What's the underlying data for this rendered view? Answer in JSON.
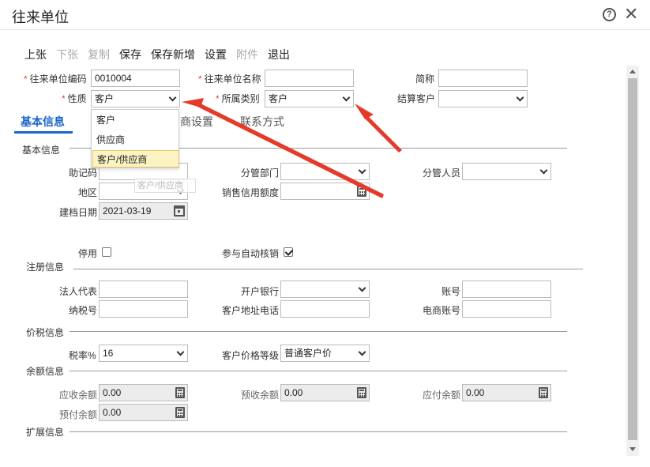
{
  "window": {
    "title": "往来单位",
    "help_icon": "question-circle-icon",
    "close_icon": "close-icon",
    "close_glyph": "✕",
    "help_glyph": "?"
  },
  "toolbar": {
    "prev": "上张",
    "next": "下张",
    "copy": "复制",
    "save": "保存",
    "save_new": "保存新增",
    "settings": "设置",
    "attachment": "附件",
    "exit": "退出"
  },
  "header_fields": {
    "code_label": "往来单位编码",
    "code_value": "0010004",
    "name_label": "往来单位名称",
    "name_value": "",
    "short_label": "简称",
    "short_value": "",
    "nature_label": "性质",
    "nature_value": "客户",
    "category_label": "所属类别",
    "category_value": "客户",
    "settle_label": "结算客户",
    "settle_value": "",
    "required_mark": "*"
  },
  "nature_dropdown": {
    "options": [
      "客户",
      "供应商",
      "客户/供应商"
    ],
    "highlighted": "客户/供应商"
  },
  "tabs": [
    {
      "label": "基本信息"
    },
    {
      "label": "商设置"
    },
    {
      "label": "联系方式"
    }
  ],
  "ghost_tooltip": "客户/供应商",
  "basic": {
    "section_label": "基本信息",
    "mnemonic_label": "助记码",
    "mnemonic_value": "",
    "dept_label": "分管部门",
    "dept_value": "",
    "staff_label": "分管人员",
    "staff_value": "",
    "region_label": "地区",
    "region_value": "",
    "credit_label": "销售信用额度",
    "credit_value": "",
    "created_label": "建档日期",
    "created_value": "2021-03-19",
    "disabled_label": "停用",
    "disabled_checked": false,
    "auto_writeoff_label": "参与自动核销",
    "auto_writeoff_checked": true
  },
  "registration": {
    "section_label": "注册信息",
    "legal_rep_label": "法人代表",
    "legal_rep_value": "",
    "bank_label": "开户银行",
    "bank_value": "",
    "account_label": "账号",
    "account_value": "",
    "tax_id_label": "纳税号",
    "tax_id_value": "",
    "address_phone_label": "客户地址电话",
    "address_phone_value": "",
    "ecommerce_label": "电商账号",
    "ecommerce_value": ""
  },
  "pricing": {
    "section_label": "价税信息",
    "tax_rate_label": "税率%",
    "tax_rate_value": "16",
    "price_level_label": "客户价格等级",
    "price_level_value": "普通客户价"
  },
  "balance": {
    "section_label": "余额信息",
    "receivable_label": "应收余额",
    "receivable_value": "0.00",
    "advance_received_label": "预收余额",
    "advance_received_value": "0.00",
    "payable_label": "应付余额",
    "payable_value": "0.00",
    "prepaid_label": "预付余额",
    "prepaid_value": "0.00"
  },
  "extension": {
    "section_label": "扩展信息"
  },
  "colors": {
    "accent": "#1a66c9",
    "required": "#e43",
    "arrow": "#e53a2a"
  }
}
